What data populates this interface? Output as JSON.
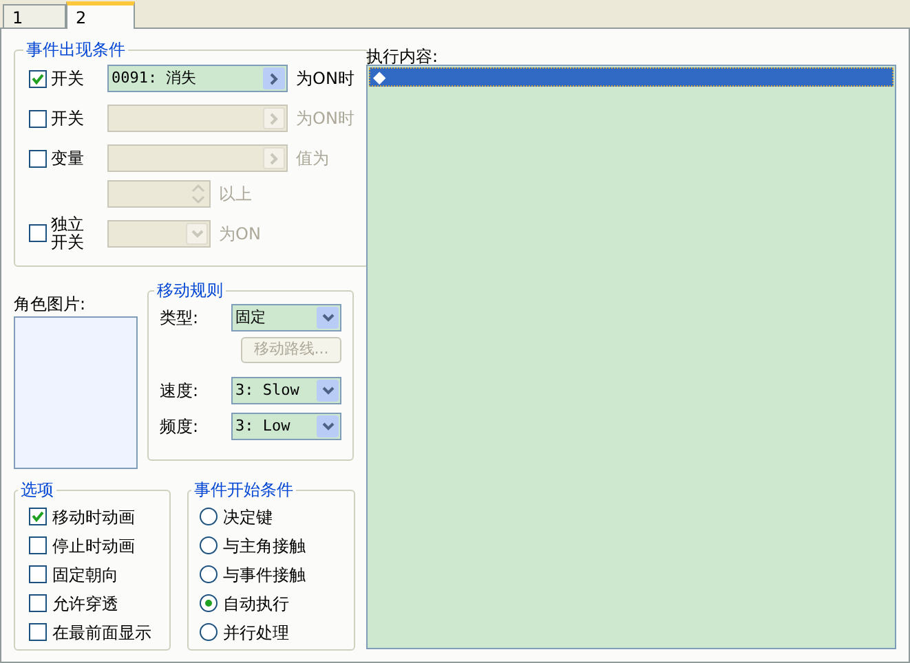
{
  "tabs": [
    {
      "label": "1",
      "selected": false
    },
    {
      "label": "2",
      "selected": true
    }
  ],
  "conditions": {
    "title": "事件出现条件",
    "rows": [
      {
        "kind": "switch",
        "label": "开关",
        "checked": true,
        "value": "0091: 消失",
        "suffix": "为ON时"
      },
      {
        "kind": "switch",
        "label": "开关",
        "checked": false,
        "suffix": "为ON时"
      },
      {
        "kind": "variable",
        "label": "变量",
        "checked": false,
        "suffix": "值为",
        "spin_suffix": "以上"
      },
      {
        "kind": "self_switch",
        "label": "独立开关",
        "checked": false,
        "suffix": "为ON"
      }
    ]
  },
  "graphic": {
    "label": "角色图片:"
  },
  "movement": {
    "title": "移动规则",
    "type_label": "类型:",
    "type_value": "固定",
    "route_button": "移动路线...",
    "route_disabled": true,
    "speed_label": "速度:",
    "speed_value": "3: Slow",
    "freq_label": "频度:",
    "freq_value": "3: Low"
  },
  "options": {
    "title": "选项",
    "items": [
      {
        "label": "移动时动画",
        "checked": true
      },
      {
        "label": "停止时动画",
        "checked": false
      },
      {
        "label": "固定朝向",
        "checked": false
      },
      {
        "label": "允许穿透",
        "checked": false
      },
      {
        "label": "在最前面显示",
        "checked": false
      }
    ]
  },
  "trigger": {
    "title": "事件开始条件",
    "items": [
      {
        "label": "决定键",
        "selected": false
      },
      {
        "label": "与主角接触",
        "selected": false
      },
      {
        "label": "与事件接触",
        "selected": false
      },
      {
        "label": "自动执行",
        "selected": true
      },
      {
        "label": "并行处理",
        "selected": false
      }
    ]
  },
  "commands": {
    "label": "执行内容:",
    "items": [
      {
        "text": "◆",
        "selected": true
      }
    ]
  }
}
